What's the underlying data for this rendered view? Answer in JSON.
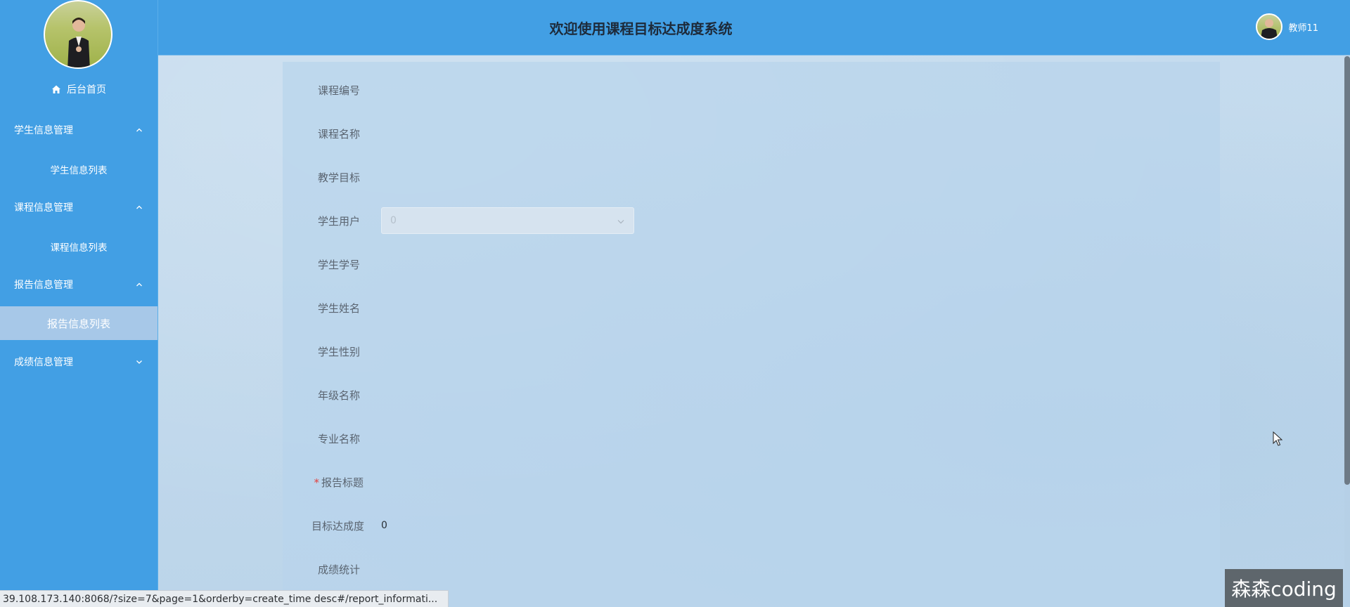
{
  "header": {
    "title": "欢迎使用课程目标达成度系统",
    "user_name": "教师11"
  },
  "sidebar": {
    "home_label": "后台首页",
    "groups": [
      {
        "label": "学生信息管理",
        "items": [
          "学生信息列表"
        ],
        "expanded": true
      },
      {
        "label": "课程信息管理",
        "items": [
          "课程信息列表"
        ],
        "expanded": true
      },
      {
        "label": "报告信息管理",
        "items": [
          "报告信息列表"
        ],
        "expanded": true,
        "active_item": "报告信息列表"
      },
      {
        "label": "成绩信息管理",
        "items": [],
        "expanded": false
      }
    ]
  },
  "form": {
    "fields": [
      {
        "label": "课程编号",
        "required": false
      },
      {
        "label": "课程名称",
        "required": false
      },
      {
        "label": "教学目标",
        "required": false
      },
      {
        "label": "学生用户",
        "required": false,
        "value": "0",
        "type": "select"
      },
      {
        "label": "学生学号",
        "required": false
      },
      {
        "label": "学生姓名",
        "required": false
      },
      {
        "label": "学生性别",
        "required": false
      },
      {
        "label": "年级名称",
        "required": false
      },
      {
        "label": "专业名称",
        "required": false
      },
      {
        "label": "报告标题",
        "required": true,
        "required_mark": "*"
      },
      {
        "label": "目标达成度",
        "required": false,
        "value": "0"
      },
      {
        "label": "成绩统计",
        "required": false
      }
    ]
  },
  "status_bar": {
    "url": "39.108.173.140:8068/?size=7&page=1&orderby=create_time desc#/report_informati..."
  },
  "watermark": {
    "text": "森森coding"
  },
  "colors": {
    "sidebar_bg": "#429fe4",
    "header_bg": "#429fe4",
    "active_item_bg": "#a7c8e8",
    "required_mark": "#e2413e"
  }
}
